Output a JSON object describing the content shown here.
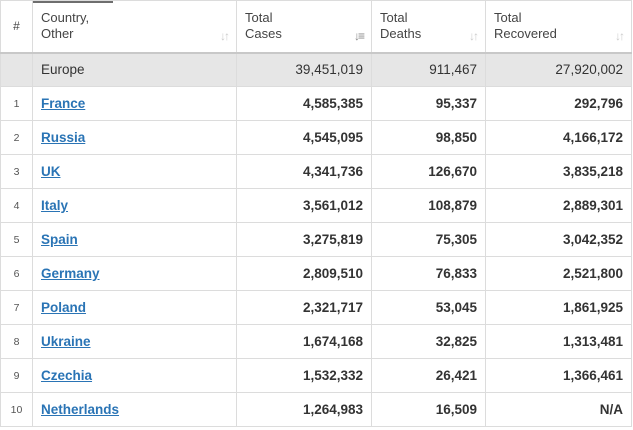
{
  "headers": {
    "index": "#",
    "country": [
      "Country,",
      "Other"
    ],
    "cases": [
      "Total",
      "Cases"
    ],
    "deaths": [
      "Total",
      "Deaths"
    ],
    "recovered": [
      "Total",
      "Recovered"
    ]
  },
  "region": {
    "name": "Europe",
    "cases": "39,451,019",
    "deaths": "911,467",
    "recovered": "27,920,002"
  },
  "rows": [
    {
      "idx": "1",
      "country": "France",
      "cases": "4,585,385",
      "deaths": "95,337",
      "recovered": "292,796"
    },
    {
      "idx": "2",
      "country": "Russia",
      "cases": "4,545,095",
      "deaths": "98,850",
      "recovered": "4,166,172"
    },
    {
      "idx": "3",
      "country": "UK",
      "cases": "4,341,736",
      "deaths": "126,670",
      "recovered": "3,835,218"
    },
    {
      "idx": "4",
      "country": "Italy",
      "cases": "3,561,012",
      "deaths": "108,879",
      "recovered": "2,889,301"
    },
    {
      "idx": "5",
      "country": "Spain",
      "cases": "3,275,819",
      "deaths": "75,305",
      "recovered": "3,042,352"
    },
    {
      "idx": "6",
      "country": "Germany",
      "cases": "2,809,510",
      "deaths": "76,833",
      "recovered": "2,521,800"
    },
    {
      "idx": "7",
      "country": "Poland",
      "cases": "2,321,717",
      "deaths": "53,045",
      "recovered": "1,861,925"
    },
    {
      "idx": "8",
      "country": "Ukraine",
      "cases": "1,674,168",
      "deaths": "32,825",
      "recovered": "1,313,481"
    },
    {
      "idx": "9",
      "country": "Czechia",
      "cases": "1,532,332",
      "deaths": "26,421",
      "recovered": "1,366,461"
    },
    {
      "idx": "10",
      "country": "Netherlands",
      "cases": "1,264,983",
      "deaths": "16,509",
      "recovered": "N/A"
    }
  ],
  "icons": {
    "sort_inactive": "sort-icon",
    "sort_active": "sort-descending-icon"
  },
  "colors": {
    "link": "#2a74b5",
    "region_bg": "#e6e6e6",
    "border": "#dcdcdc"
  }
}
